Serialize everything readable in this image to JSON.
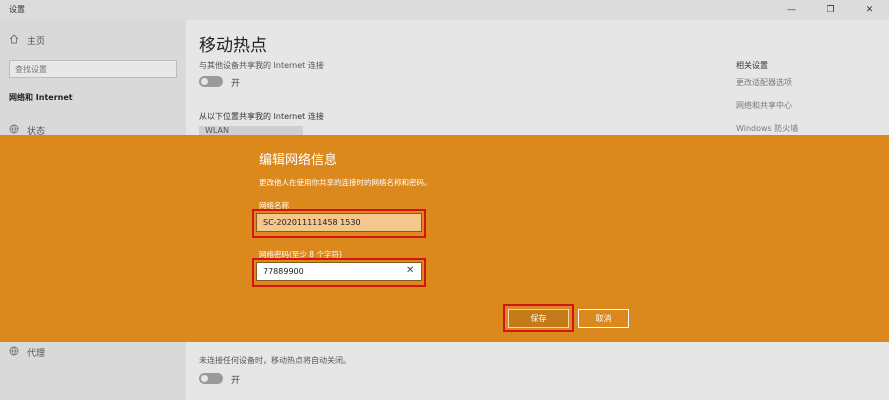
{
  "window": {
    "title": "设置",
    "minimize": "—",
    "maximize": "❐",
    "close": "✕"
  },
  "sidebar": {
    "home_label": "主页",
    "search_placeholder": "查找设置",
    "section_title": "网络和 Internet",
    "status_label": "状态",
    "proxy_label": "代理"
  },
  "main": {
    "title": "移动热点",
    "share_desc": "与其他设备共享我的 Internet 连接",
    "toggle1_label": "开",
    "share_from_label": "从以下位置共享我的 Internet 连接",
    "share_from_value": "WLAN",
    "bottom_desc": "未连接任何设备时，移动热点将自动关闭。",
    "toggle2_label": "开"
  },
  "related": {
    "title": "相关设置",
    "links": [
      "更改适配器选项",
      "网络和共享中心",
      "Windows 防火墙"
    ]
  },
  "dialog": {
    "title": "编辑网络信息",
    "description": "更改他人在使用你共享的连接时的网络名称和密码。",
    "name_label": "网络名称",
    "name_value": "SC-202011111458 1530",
    "password_label": "网络密码(至少 8 个字符)",
    "password_value": "77889900",
    "save_label": "保存",
    "cancel_label": "取消"
  },
  "colors": {
    "dialog_bg": "#db891d",
    "highlight": "#d41414"
  }
}
